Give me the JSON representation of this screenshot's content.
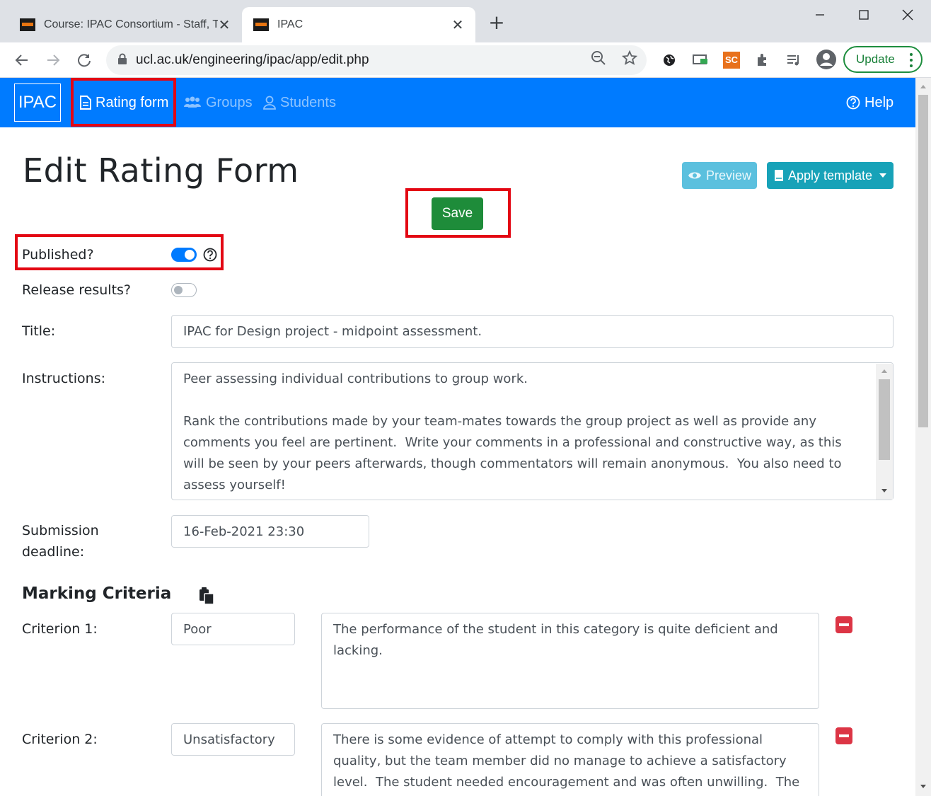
{
  "browser": {
    "tabs": [
      {
        "title": "Course: IPAC Consortium - Staff, T",
        "active": false
      },
      {
        "title": "IPAC",
        "active": true
      }
    ],
    "url": "ucl.ac.uk/engineering/ipac/app/edit.php",
    "update_label": "Update",
    "extension_badge": "SC"
  },
  "navbar": {
    "brand": "IPAC",
    "links": [
      {
        "label": "Rating form",
        "icon": "document-icon",
        "active": true
      },
      {
        "label": "Groups",
        "icon": "users-icon",
        "active": false
      },
      {
        "label": "Students",
        "icon": "user-icon",
        "active": false
      }
    ],
    "help": "Help",
    "color": "#007bff"
  },
  "page": {
    "title": "Edit Rating Form",
    "preview_label": "Preview",
    "apply_template_label": "Apply template",
    "save_label": "Save"
  },
  "form": {
    "published_label": "Published?",
    "published": true,
    "release_label": "Release results?",
    "release": false,
    "title_label": "Title:",
    "title_value": "IPAC for Design project - midpoint assessment.",
    "instructions_label": "Instructions:",
    "instructions_value": "Peer assessing individual contributions to group work.\n\nRank the contributions made by your team-mates towards the group project as well as provide any comments you feel are pertinent.  Write your comments in a professional and constructive way, as this will be seen by your peers afterwards, though commentators will remain anonymous.  You also need to assess yourself!",
    "deadline_label_1": "Submission",
    "deadline_label_2": "deadline:",
    "deadline_value": "16-Feb-2021 23:30"
  },
  "criteria": {
    "heading": "Marking Criteria",
    "items": [
      {
        "label": "Criterion 1:",
        "name": "Poor",
        "description": "The performance of the student in this category is quite deficient and lacking."
      },
      {
        "label": "Criterion 2:",
        "name": "Unsatisfactory",
        "description": "There is some evidence of attempt to comply with this professional quality, but the team member did no manage to achieve a satisfactory level.  The student needed encouragement and was often unwilling.  The performance"
      }
    ]
  },
  "colors": {
    "highlight": "#e30613",
    "save": "#1e8c3a",
    "preview": "#5bc0de",
    "template": "#17a2b8",
    "danger": "#dc3545"
  }
}
